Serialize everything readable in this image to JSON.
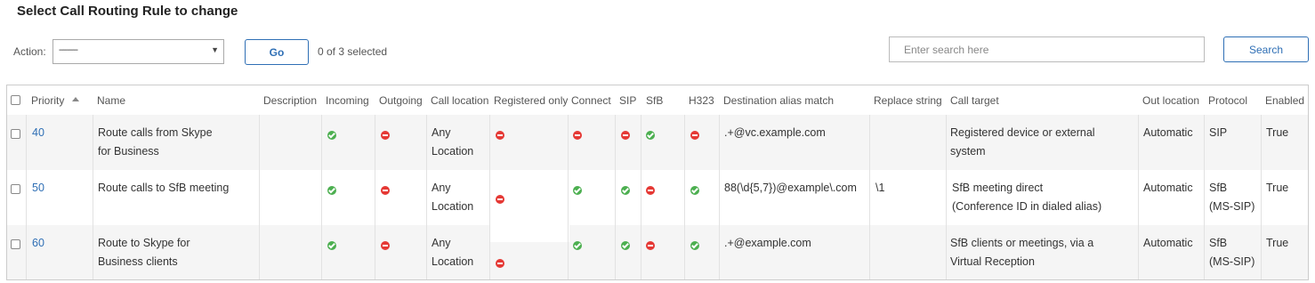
{
  "page": {
    "title": "Select Call Routing Rule to change",
    "action_label": "Action:",
    "action_value": "---------",
    "go_label": "Go",
    "selected_text": "0 of 3 selected",
    "search_placeholder": "Enter search here",
    "search_label": "Search"
  },
  "columns": [
    "Priority",
    "Name",
    "Description",
    "Incoming",
    "Outgoing",
    "Call location",
    "Registered only",
    "Connect",
    "SIP",
    "SfB",
    "H323",
    "Destination alias match",
    "Replace string",
    "Call target",
    "Out location",
    "Protocol",
    "Enabled"
  ],
  "rows": [
    {
      "priority": "40",
      "name": [
        "Route calls from Skype",
        "for Business"
      ],
      "description": "",
      "incoming": "yes",
      "outgoing": "no",
      "call_location": [
        "Any",
        "Location"
      ],
      "registered_only": "no",
      "connect": "no",
      "sip": "no",
      "sfb": "yes",
      "h323": "no",
      "destination_alias_match": ".+@vc.example.com",
      "replace_string": "",
      "call_target": [
        "Registered device or external",
        "system"
      ],
      "out_location": "Automatic",
      "protocol": [
        "SIP"
      ],
      "enabled": "True"
    },
    {
      "priority": "50",
      "name": [
        "Route calls to SfB meeting"
      ],
      "description": "",
      "incoming": "yes",
      "outgoing": "no",
      "call_location": [
        "Any",
        "Location"
      ],
      "registered_only": "no",
      "connect": "yes",
      "sip": "yes",
      "sfb": "no",
      "h323": "yes",
      "destination_alias_match": "88(\\d{5,7})@example\\.com",
      "replace_string": "\\1",
      "call_target": [
        "SfB meeting direct",
        "(Conference ID in dialed alias)"
      ],
      "out_location": "Automatic",
      "protocol": [
        "SfB",
        "(MS-SIP)"
      ],
      "enabled": "True"
    },
    {
      "priority": "60",
      "name": [
        "Route to Skype for",
        "Business clients"
      ],
      "description": "",
      "incoming": "yes",
      "outgoing": "no",
      "call_location": [
        "Any",
        "Location"
      ],
      "registered_only": "no",
      "connect": "yes",
      "sip": "yes",
      "sfb": "no",
      "h323": "yes",
      "destination_alias_match": ".+@example.com",
      "replace_string": "",
      "call_target": [
        "SfB clients or meetings, via a",
        "Virtual Reception"
      ],
      "out_location": "Automatic",
      "protocol": [
        "SfB",
        "(MS-SIP)"
      ],
      "enabled": "True"
    }
  ]
}
